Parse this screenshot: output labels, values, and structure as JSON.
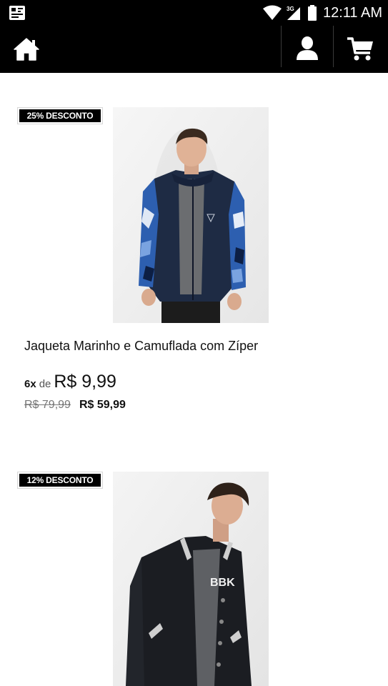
{
  "status_bar": {
    "time": "12:11 AM",
    "network": "3G",
    "icons": [
      "app-notification-icon",
      "wifi-icon",
      "signal-icon",
      "battery-icon"
    ]
  },
  "app_bar": {
    "icons": [
      "home-icon",
      "user-icon",
      "cart-icon"
    ]
  },
  "products": [
    {
      "discount": "25% DESCONTO",
      "name": "Jaqueta Marinho e Camuflada com Zíper",
      "installment_count": "6x",
      "installment_de": "de",
      "installment_value": "R$ 9,99",
      "old_price": "R$ 79,99",
      "new_price": "R$ 59,99"
    },
    {
      "discount": "12% DESCONTO",
      "print_text": "BBK"
    }
  ]
}
